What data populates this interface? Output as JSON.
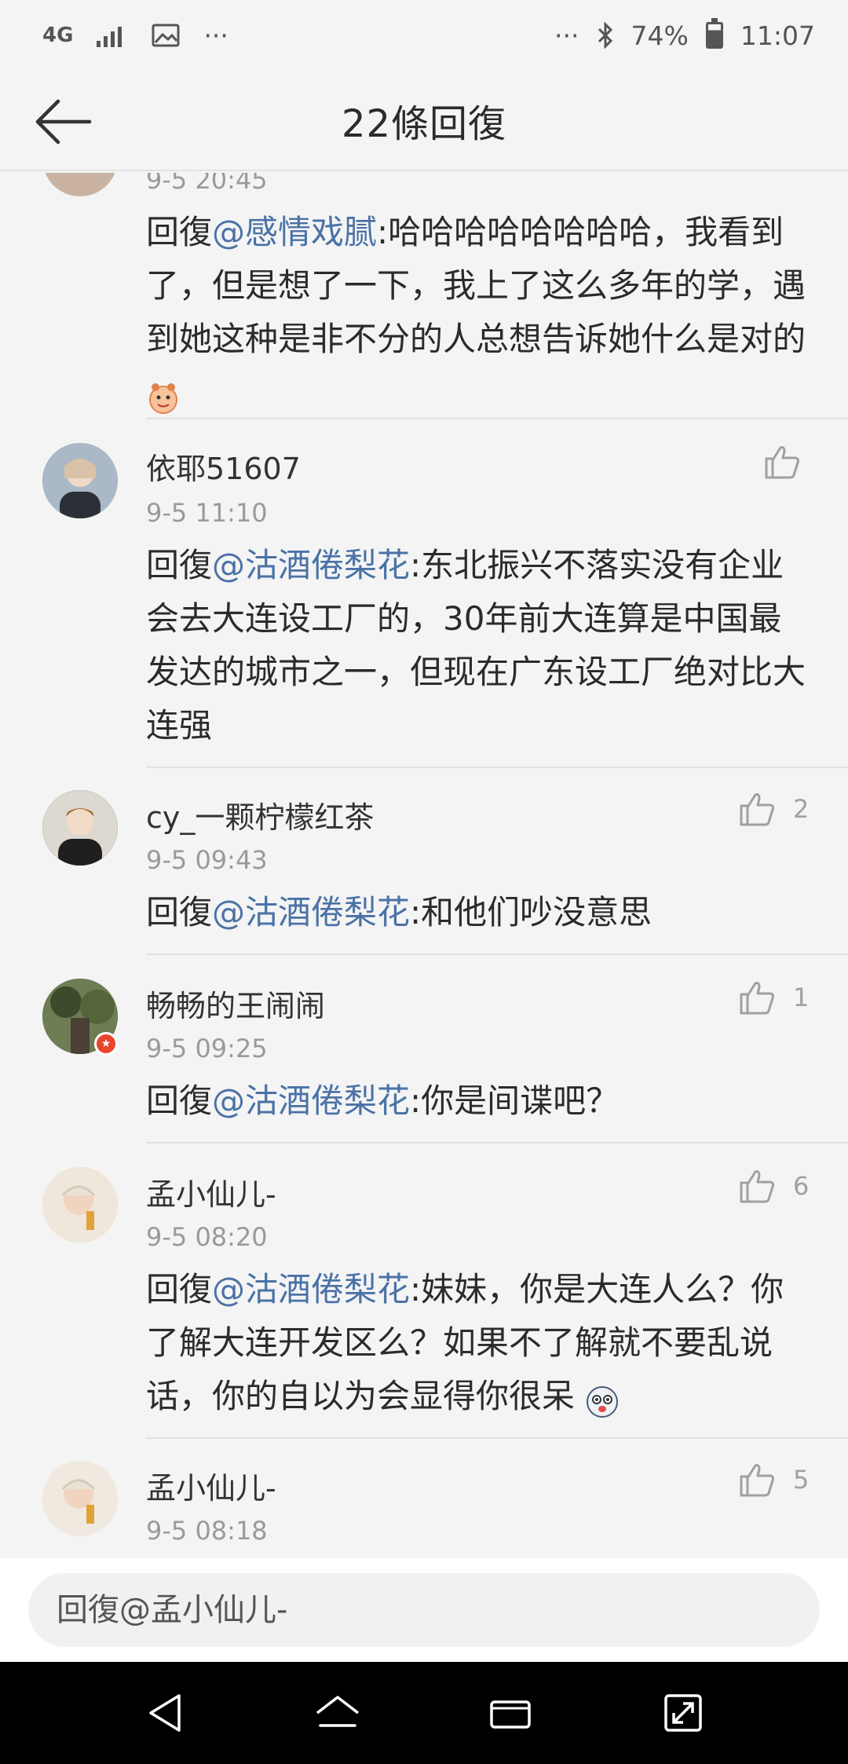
{
  "status_bar": {
    "network": "4G",
    "more_left": "···",
    "more_right": "···",
    "battery": "74%",
    "time": "11:07"
  },
  "header": {
    "title": "22條回復"
  },
  "comments": [
    {
      "time": "9-5 20:45",
      "reply_prefix": "回復",
      "mention": "@感情戏腻",
      "text": ":哈哈哈哈哈哈哈哈，我看到了，但是想了一下，我上了这么多年的学，遇到她这种是非不分的人总想告诉她什么是对的"
    },
    {
      "username": "依耶51607",
      "time": "9-5 11:10",
      "reply_prefix": "回復",
      "mention": "@沽酒倦梨花",
      "text": ":东北振兴不落实没有企业会去大连设工厂的，30年前大连算是中国最发达的城市之一，但现在广东设工厂绝对比大连强",
      "likes": ""
    },
    {
      "username": "cy_一颗柠檬红茶",
      "time": "9-5 09:43",
      "reply_prefix": "回復",
      "mention": "@沽酒倦梨花",
      "text": ":和他们吵没意思",
      "likes": "2"
    },
    {
      "username": "畅畅的王闹闹",
      "time": "9-5 09:25",
      "reply_prefix": "回復",
      "mention": "@沽酒倦梨花",
      "text": ":你是间谍吧？",
      "likes": "1"
    },
    {
      "username": "孟小仙儿-",
      "time": "9-5 08:20",
      "reply_prefix": "回復",
      "mention": "@沽酒倦梨花",
      "text": ":妹妹，你是大连人么？你了解大连开发区么？如果不了解就不要乱说话，你的自以为会显得你很呆",
      "likes": "6"
    },
    {
      "username": "孟小仙儿-",
      "time": "9-5 08:18",
      "likes": "5"
    }
  ],
  "input": {
    "placeholder": "回復@孟小仙儿-"
  },
  "colors": {
    "mention": "#4a72a6",
    "background": "#f4f4f4",
    "nav": "#000000"
  },
  "icons": [
    "back-arrow-icon",
    "thumbs-up-icon",
    "nav-back-icon",
    "nav-home-icon",
    "nav-recents-icon",
    "nav-expand-icon"
  ]
}
